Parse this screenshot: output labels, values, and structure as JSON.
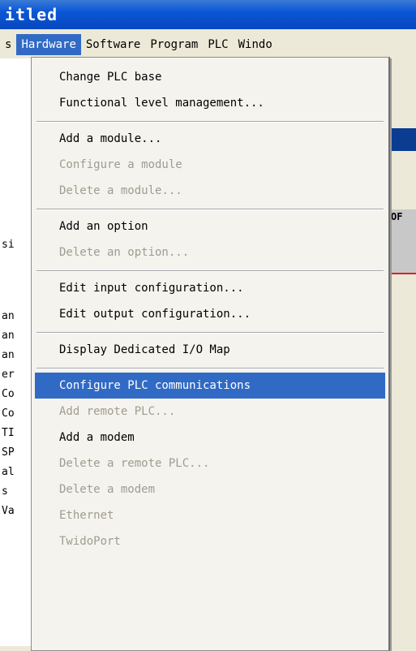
{
  "window": {
    "title": "itled"
  },
  "menubar": [
    {
      "label": "s"
    },
    {
      "label": "Hardware",
      "active": true
    },
    {
      "label": "Software"
    },
    {
      "label": "Program"
    },
    {
      "label": "PLC"
    },
    {
      "label": "Windo"
    }
  ],
  "menu": {
    "items": [
      {
        "label": "Change PLC base",
        "disabled": false
      },
      {
        "label": "Functional level management...",
        "disabled": false
      },
      {
        "separator": true
      },
      {
        "label": "Add a module...",
        "disabled": false
      },
      {
        "label": "Configure a module",
        "disabled": true
      },
      {
        "label": "Delete a module...",
        "disabled": true
      },
      {
        "separator": true
      },
      {
        "label": "Add an option",
        "disabled": false
      },
      {
        "label": "Delete an option...",
        "disabled": true
      },
      {
        "separator": true
      },
      {
        "label": "Edit input configuration...",
        "disabled": false
      },
      {
        "label": "Edit output configuration...",
        "disabled": false
      },
      {
        "separator": true
      },
      {
        "label": "Display Dedicated I/O Map",
        "disabled": false
      },
      {
        "separator": true
      },
      {
        "label": "Configure PLC communications",
        "disabled": false,
        "selected": true
      },
      {
        "label": "Add remote PLC...",
        "disabled": true
      },
      {
        "label": "Add a modem",
        "disabled": false
      },
      {
        "label": "Delete a remote PLC...",
        "disabled": true
      },
      {
        "label": "Delete a modem",
        "disabled": true
      },
      {
        "label": "Ethernet",
        "disabled": true
      },
      {
        "label": "TwidoPort",
        "disabled": true
      }
    ]
  },
  "left_panel": [
    "si",
    "an",
    "an",
    "an",
    "er",
    "Co",
    "Co",
    "TI",
    "SP",
    "al",
    "s",
    "Va"
  ],
  "right_fragments": {
    "label": "OF"
  },
  "colors": {
    "title_bar": "#0a56d6",
    "selection": "#316ac5",
    "disabled_text": "#a09c8e"
  }
}
